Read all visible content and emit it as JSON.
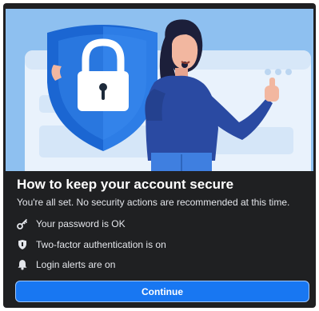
{
  "dialog": {
    "title": "How to keep your account secure",
    "subtitle": "You're all set. No security actions are recommended at this time.",
    "items": [
      {
        "icon": "key-icon",
        "label": "Your password is OK"
      },
      {
        "icon": "shield-icon",
        "label": "Two-factor authentication is on"
      },
      {
        "icon": "bell-icon",
        "label": "Login alerts are on"
      }
    ],
    "continue_label": "Continue"
  },
  "colors": {
    "background": "#1f2022",
    "accent": "#1877f2",
    "hero_background": "#8ec0f0"
  },
  "hero": {
    "illustration": "woman-with-padlock-shield-thumbs-up"
  }
}
